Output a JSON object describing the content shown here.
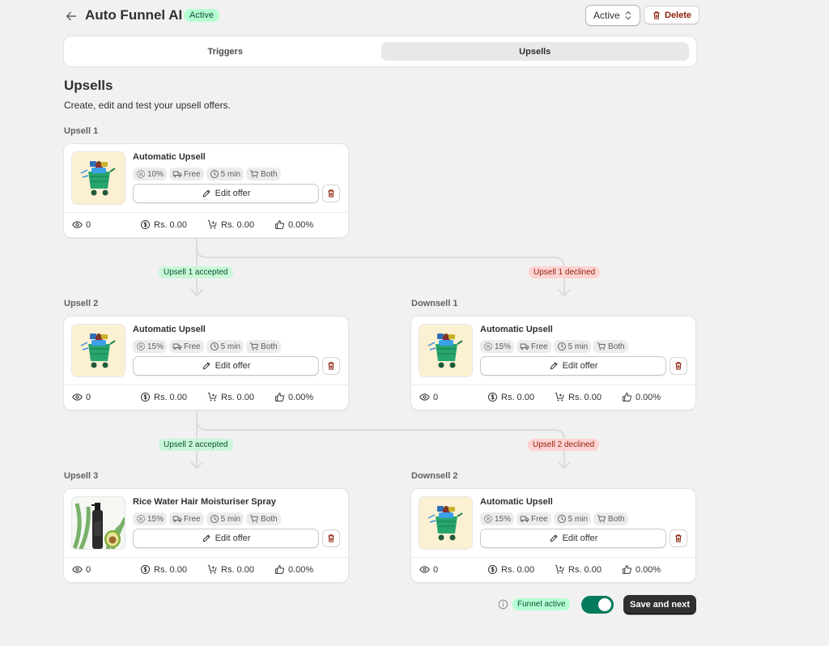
{
  "header": {
    "title": "Auto Funnel AI",
    "status_badge": "Active",
    "status_select": "Active",
    "delete_label": "Delete"
  },
  "tabs": [
    {
      "label": "Triggers",
      "selected": false
    },
    {
      "label": "Upsells",
      "selected": true
    }
  ],
  "section": {
    "title": "Upsells",
    "description": "Create, edit and test your upsell offers."
  },
  "stages": {
    "upsell1": {
      "label": "Upsell 1",
      "card": {
        "name": "Automatic Upsell",
        "image": "shopping-cart-illustration",
        "discount": "10%",
        "shipping": "Free",
        "timer": "5 min",
        "target": "Both",
        "edit_label": "Edit offer",
        "views": "0",
        "revenue": "Rs. 0.00",
        "cart_value": "Rs. 0.00",
        "conversion": "0.00%"
      }
    },
    "upsell2": {
      "label": "Upsell 2",
      "card": {
        "name": "Automatic Upsell",
        "image": "shopping-cart-illustration",
        "discount": "15%",
        "shipping": "Free",
        "timer": "5 min",
        "target": "Both",
        "edit_label": "Edit offer",
        "views": "0",
        "revenue": "Rs. 0.00",
        "cart_value": "Rs. 0.00",
        "conversion": "0.00%"
      }
    },
    "downsell1": {
      "label": "Downsell 1",
      "card": {
        "name": "Automatic Upsell",
        "image": "shopping-cart-illustration",
        "discount": "15%",
        "shipping": "Free",
        "timer": "5 min",
        "target": "Both",
        "edit_label": "Edit offer",
        "views": "0",
        "revenue": "Rs. 0.00",
        "cart_value": "Rs. 0.00",
        "conversion": "0.00%"
      }
    },
    "upsell3": {
      "label": "Upsell 3",
      "card": {
        "name": "Rice Water Hair Moisturiser Spray",
        "image": "spray-bottle-photo",
        "discount": "15%",
        "shipping": "Free",
        "timer": "5 min",
        "target": "Both",
        "edit_label": "Edit offer",
        "views": "0",
        "revenue": "Rs. 0.00",
        "cart_value": "Rs. 0.00",
        "conversion": "0.00%"
      }
    },
    "downsell2": {
      "label": "Downsell 2",
      "card": {
        "name": "Automatic Upsell",
        "image": "shopping-cart-illustration",
        "discount": "15%",
        "shipping": "Free",
        "timer": "5 min",
        "target": "Both",
        "edit_label": "Edit offer",
        "views": "0",
        "revenue": "Rs. 0.00",
        "cart_value": "Rs. 0.00",
        "conversion": "0.00%"
      }
    }
  },
  "flow": {
    "upsell1_accepted": "Upsell 1 accepted",
    "upsell1_declined": "Upsell 1 declined",
    "upsell2_accepted": "Upsell 2 accepted",
    "upsell2_declined": "Upsell 2 declined"
  },
  "footer": {
    "funnel_badge": "Funnel active",
    "toggle_on": true,
    "save_label": "Save and next"
  },
  "colors": {
    "background": "#f1f1f1",
    "success_bg": "#b4fed2",
    "success_text": "#0c5132",
    "critical_bg": "#fed3d1",
    "critical_text": "#8e1f0b",
    "toggle_on": "#047b5d",
    "primary_button": "#303030"
  }
}
